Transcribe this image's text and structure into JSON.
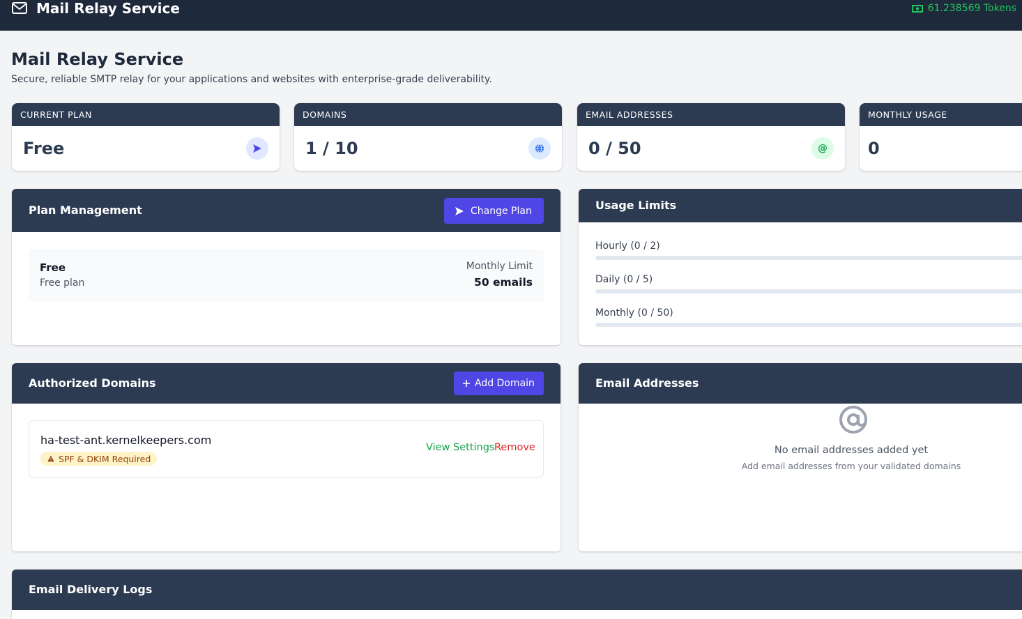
{
  "header": {
    "app_title": "Mail Relay Service",
    "tokens": "61.238569 Tokens",
    "logo_icon": "envelope-icon",
    "tokens_icon": "money-icon"
  },
  "page": {
    "title": "Mail Relay Service",
    "subtitle": "Secure, reliable SMTP relay for your applications and websites with enterprise-grade deliverability."
  },
  "stats": [
    {
      "label": "CURRENT PLAN",
      "value": "Free",
      "icon": "send-icon",
      "icon_color": "#4f46e5",
      "icon_bg": "#e0e7ff"
    },
    {
      "label": "DOMAINS",
      "value": "1 / 10",
      "icon": "globe-icon",
      "icon_color": "#2563eb",
      "icon_bg": "#dbeafe"
    },
    {
      "label": "EMAIL ADDRESSES",
      "value": "0 / 50",
      "icon": "at-icon",
      "icon_color": "#16a34a",
      "icon_bg": "#dcfce7"
    },
    {
      "label": "MONTHLY USAGE",
      "value": "0"
    }
  ],
  "plan_management": {
    "title": "Plan Management",
    "change_button": "Change Plan",
    "plan_name": "Free",
    "plan_desc": "Free plan",
    "limit_label": "Monthly Limit",
    "limit_value": "50 emails"
  },
  "usage_limits": {
    "title": "Usage Limits",
    "rows": [
      {
        "label": "Hourly (0 / 2)",
        "fraction": 0
      },
      {
        "label": "Daily (0 / 5)",
        "fraction": 0
      },
      {
        "label": "Monthly (0 / 50)",
        "fraction": 0
      }
    ]
  },
  "domains": {
    "title": "Authorized Domains",
    "add_button": "Add Domain",
    "items": [
      {
        "name": "ha-test-ant.kernelkeepers.com",
        "warning": "SPF & DKIM Required",
        "view_link": "View Settings",
        "remove_link": "Remove"
      }
    ]
  },
  "email_addresses": {
    "title": "Email Addresses",
    "empty_title": "No email addresses added yet",
    "empty_sub": "Add email addresses from your validated domains"
  },
  "logs": {
    "title": "Email Delivery Logs"
  },
  "colors": {
    "navy": "#1e293b",
    "panel_header": "#2d3b52",
    "primary": "#4f46e5",
    "success": "#16a34a",
    "danger": "#dc2626",
    "token_green": "#22c55e"
  }
}
